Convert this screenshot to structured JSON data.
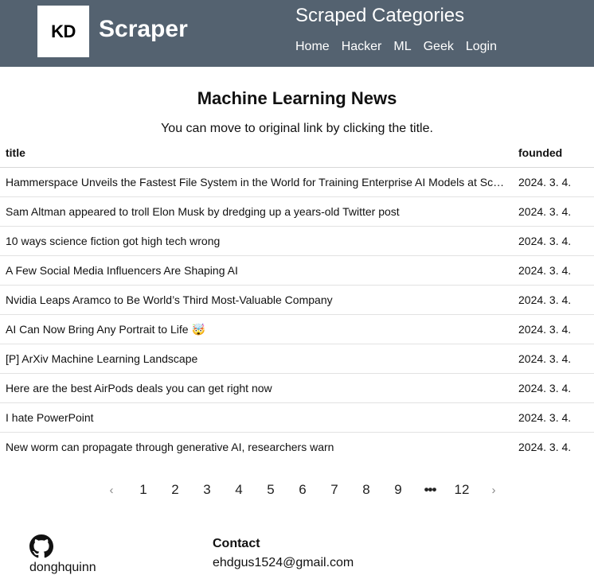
{
  "header": {
    "logo_text": "KD",
    "brand": "Scraper",
    "title": "Scraped Categories",
    "nav": [
      "Home",
      "Hacker",
      "ML",
      "Geek",
      "Login"
    ]
  },
  "main": {
    "title": "Machine Learning News",
    "subtitle": "You can move to original link by clicking the title.",
    "columns": [
      "title",
      "founded"
    ],
    "rows": [
      {
        "title": "Hammerspace Unveils the Fastest File System in the World for Training Enterprise AI Models at Scale",
        "date": "2024. 3. 4."
      },
      {
        "title": "Sam Altman appeared to troll Elon Musk by dredging up a years-old Twitter post",
        "date": "2024. 3. 4."
      },
      {
        "title": "10 ways science fiction got high tech wrong",
        "date": "2024. 3. 4."
      },
      {
        "title": "A Few Social Media Influencers Are Shaping AI",
        "date": "2024. 3. 4."
      },
      {
        "title": "Nvidia Leaps Aramco to Be World’s Third Most-Valuable Company",
        "date": "2024. 3. 4."
      },
      {
        "title": "AI Can Now Bring Any Portrait to Life 🤯",
        "date": "2024. 3. 4."
      },
      {
        "title": "[P] ArXiv Machine Learning Landscape",
        "date": "2024. 3. 4."
      },
      {
        "title": "Here are the best AirPods deals you can get right now",
        "date": "2024. 3. 4."
      },
      {
        "title": "I hate PowerPoint",
        "date": "2024. 3. 4."
      },
      {
        "title": "New worm can propagate through generative AI, researchers warn",
        "date": "2024. 3. 4."
      }
    ]
  },
  "pagination": {
    "prev": "‹",
    "pages": [
      "1",
      "2",
      "3",
      "4",
      "5",
      "6",
      "7",
      "8",
      "9"
    ],
    "ellipsis": "•••",
    "last": "12",
    "next": "›"
  },
  "footer": {
    "github_icon": "github-icon",
    "username": "donghquinn",
    "contact_label": "Contact",
    "email": "ehdgus1524@gmail.com"
  }
}
